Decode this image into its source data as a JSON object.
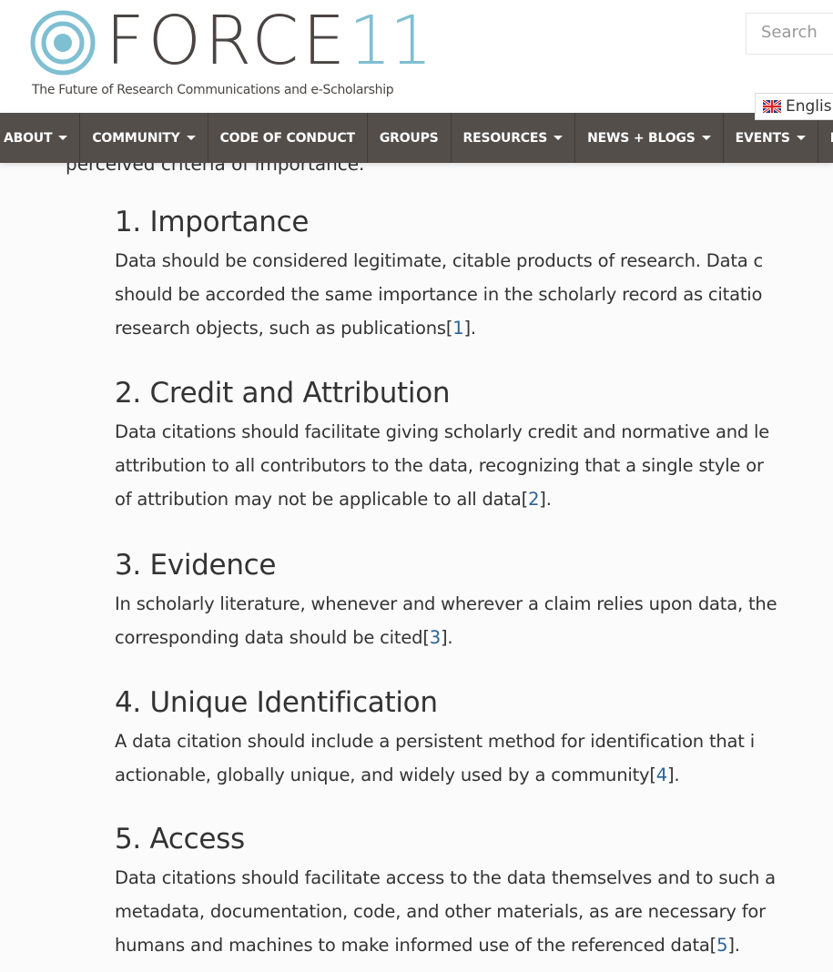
{
  "header": {
    "logo_text": "FORCE",
    "logo_number": "11",
    "tagline": "The Future of Research Communications and e-Scholarship",
    "search_placeholder": "Search",
    "language": "English",
    "brand_colors": {
      "dark": "#4a4543",
      "accent": "#7fbfd2"
    }
  },
  "nav": {
    "background": "#544e4b",
    "items": [
      {
        "label": "ABOUT",
        "dropdown": true
      },
      {
        "label": "COMMUNITY",
        "dropdown": true
      },
      {
        "label": "CODE OF CONDUCT",
        "dropdown": false
      },
      {
        "label": "GROUPS",
        "dropdown": false
      },
      {
        "label": "RESOURCES",
        "dropdown": true
      },
      {
        "label": "NEWS + BLOGS",
        "dropdown": true
      },
      {
        "label": "EVENTS",
        "dropdown": true
      },
      {
        "label": "PUBLICA",
        "dropdown": false
      }
    ]
  },
  "content": {
    "lead_fragment": "perceived criteria of importance.",
    "sections": [
      {
        "title": "1. Importance",
        "lines": [
          "Data should be considered legitimate, citable products of research. Data c",
          "should be accorded the same importance in the scholarly record as citatio",
          "research objects, such as publications"
        ],
        "ref": "1"
      },
      {
        "title": "2. Credit and Attribution",
        "lines": [
          "Data citations should facilitate giving scholarly credit and normative and le",
          "attribution to all contributors to the data, recognizing that a single style or",
          "of attribution may not be applicable to all data"
        ],
        "ref": "2"
      },
      {
        "title": "3. Evidence",
        "lines": [
          "In scholarly literature, whenever and wherever a claim relies upon data, the",
          "corresponding data should be cited"
        ],
        "ref": "3"
      },
      {
        "title": "4. Unique Identification",
        "lines": [
          "A data citation should include a persistent method for identification that i",
          "actionable, globally unique, and widely used by a community"
        ],
        "ref": "4"
      },
      {
        "title": "5. Access",
        "lines": [
          "Data citations should facilitate access to the data themselves and to such a",
          "metadata, documentation, code, and other materials, as are necessary for",
          "humans and machines to make informed use of the referenced data"
        ],
        "ref": "5"
      }
    ],
    "link_color": "#2a6496"
  }
}
